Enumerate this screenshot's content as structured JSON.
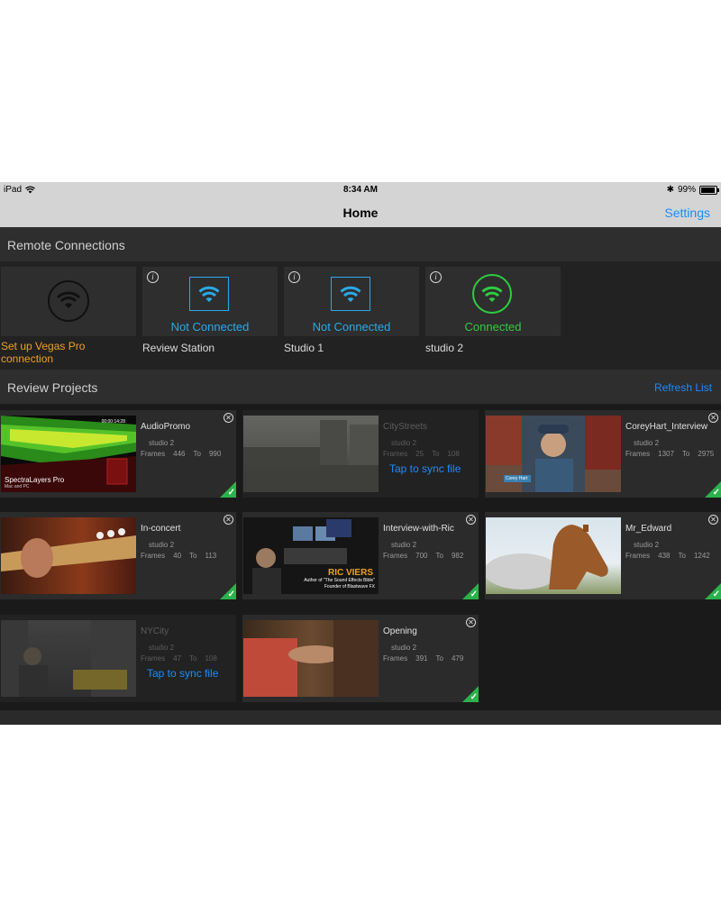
{
  "status": {
    "device": "iPad",
    "time": "8:34 AM",
    "battery": "99%"
  },
  "nav": {
    "title": "Home",
    "settings": "Settings"
  },
  "remote": {
    "header": "Remote Connections",
    "setup": {
      "label": "Set up Vegas Pro connection"
    },
    "connections": [
      {
        "status": "Not Connected",
        "name": "Review Station",
        "connected": false
      },
      {
        "status": "Not Connected",
        "name": "Studio 1",
        "connected": false
      },
      {
        "status": "Connected",
        "name": "studio 2",
        "connected": true
      }
    ]
  },
  "review": {
    "header": "Review Projects",
    "refresh": "Refresh List",
    "frames_label": "Frames",
    "to_label": "To",
    "projects": [
      {
        "title": "AudioPromo",
        "server": "studio 2",
        "from": "446",
        "to": "990",
        "synced": true
      },
      {
        "title": "CityStreets",
        "server": "studio 2",
        "from": "25",
        "to": "108",
        "synced": false,
        "action": "Tap to sync file"
      },
      {
        "title": "CoreyHart_Interview",
        "server": "studio 2",
        "from": "1307",
        "to": "2975",
        "synced": true
      },
      {
        "title": "In-concert",
        "server": "studio 2",
        "from": "40",
        "to": "113",
        "synced": true
      },
      {
        "title": "Interview-with-Ric",
        "server": "studio 2",
        "from": "700",
        "to": "982",
        "synced": true
      },
      {
        "title": "Mr_Edward",
        "server": "studio 2",
        "from": "438",
        "to": "1242",
        "synced": true
      },
      {
        "title": "NYCity",
        "server": "studio 2",
        "from": "47",
        "to": "108",
        "synced": false,
        "action": "Tap to sync file"
      },
      {
        "title": "Opening",
        "server": "studio 2",
        "from": "391",
        "to": "479",
        "synced": true
      }
    ]
  },
  "thumb_text": {
    "audiopromo_brand": "SpectraLayers Pro",
    "audiopromo_sub": "Mac and PC",
    "audiopromo_time": "00:00:14:28",
    "ric_name": "RIC VIERS",
    "ric_line1": "Author of \"The Sound Effects Bible\"",
    "ric_line2": "Founder of Blastwave FX",
    "corey_lower": "Corey Hart"
  },
  "colors": {
    "accent": "#1a8cff",
    "connected": "#2ecc40",
    "wifi": "#29a9e8",
    "setup": "#f0a020",
    "synced": "#2bb24c"
  }
}
